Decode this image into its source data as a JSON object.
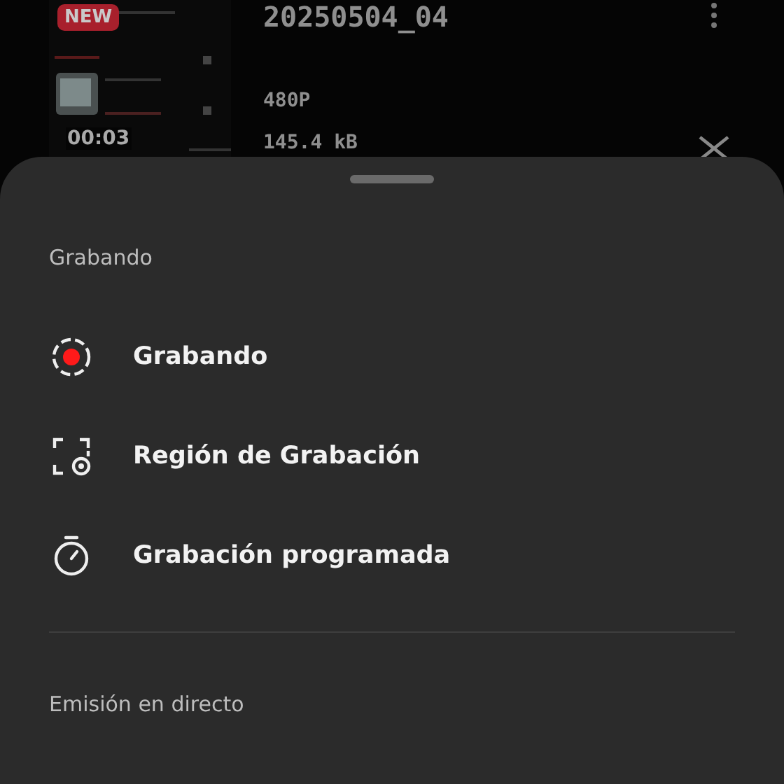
{
  "background": {
    "thumbnail": {
      "badge": "NEW",
      "duration": "00:03"
    },
    "file_name": "20250504_04",
    "resolution": "480P",
    "size": "145.4 kB"
  },
  "sheet": {
    "sections": [
      {
        "title": "Grabando",
        "items": [
          {
            "kind": "record",
            "label": "Grabando"
          },
          {
            "kind": "region",
            "label": "Región de Grabación"
          },
          {
            "kind": "timer",
            "label": "Grabación programada"
          }
        ]
      },
      {
        "title": "Emisión en directo"
      }
    ]
  }
}
